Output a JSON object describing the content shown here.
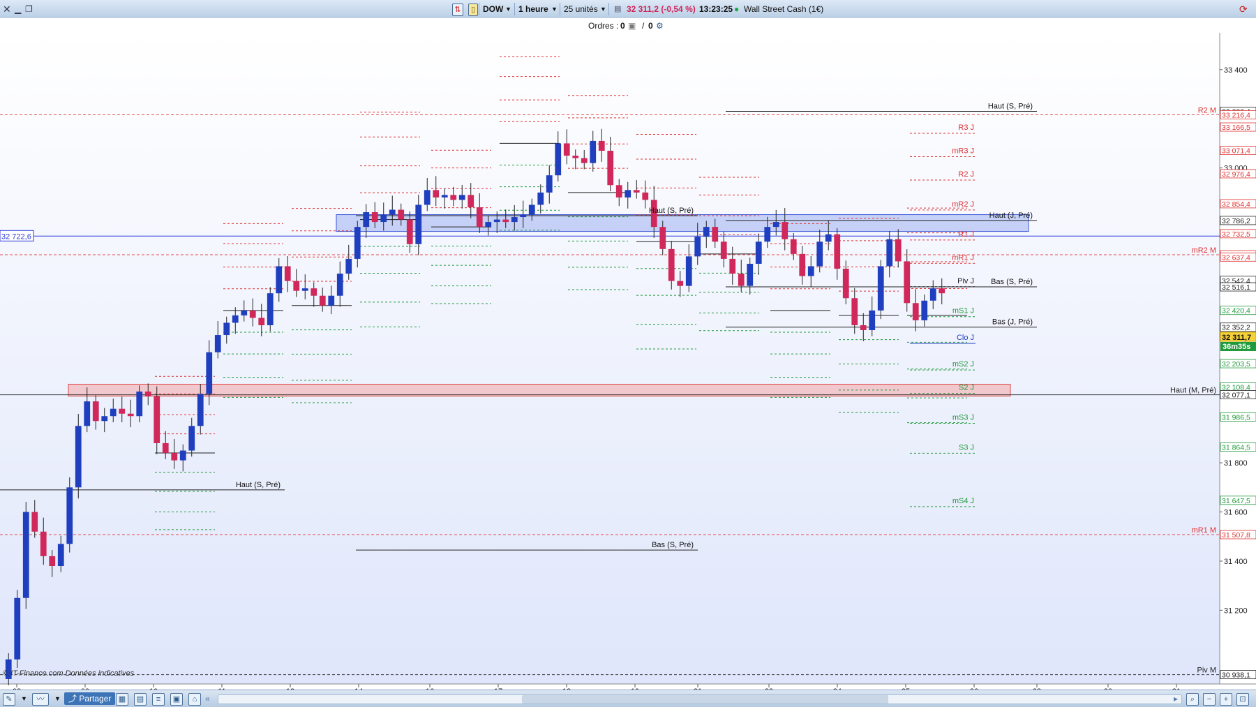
{
  "header": {
    "window_controls": [
      "close-icon",
      "minimize-icon",
      "restore-icon"
    ],
    "symbol": "DOW",
    "timeframe": "1 heure",
    "units": "25 unités",
    "price_info": "32 311,2 (-0,54 %)",
    "time": "13:23:25",
    "instrument": "Wall Street Cash (1€)"
  },
  "orders": {
    "label": "Ordres :",
    "open": "0",
    "sep": "/",
    "pending": "0"
  },
  "footer": {
    "watermark": "© IT-Finance.com  Données indicatives",
    "share_label": "Partager"
  },
  "colors": {
    "bull": "#1f3fbf",
    "bear": "#d0285a",
    "red_level": "#e03030",
    "green_level": "#1f9a3a",
    "zone_blue": "#9fb0f0",
    "zone_red": "#f4a6a6"
  },
  "chart_data": {
    "type": "candlestick",
    "instrument": "DOW",
    "interval": "1 heure",
    "ylim": [
      30900,
      33550
    ],
    "y_ticks": [
      31200,
      31400,
      31600,
      31800,
      33000,
      33400
    ],
    "x_ticks": [
      "08",
      "09",
      "10",
      "11",
      "12",
      "14",
      "16",
      "17",
      "18",
      "19",
      "21",
      "23",
      "24",
      "25",
      "26",
      "28",
      "30",
      "31"
    ],
    "current_price": "32 311,7",
    "countdown": "36m35s",
    "left_marker": "32 722,6",
    "price_labels": [
      {
        "text": "33 230,4",
        "value": 33230.4,
        "color": "#222222"
      },
      {
        "text": "33 216,4",
        "value": 33216.4,
        "color": "#e03030"
      },
      {
        "text": "33 166,5",
        "value": 33166.5,
        "color": "#e03030"
      },
      {
        "text": "33 071,4",
        "value": 33071.4,
        "color": "#e03030"
      },
      {
        "text": "32 976,4",
        "value": 32976.4,
        "color": "#e03030"
      },
      {
        "text": "32 854,4",
        "value": 32854.4,
        "color": "#e03030"
      },
      {
        "text": "32 786,2",
        "value": 32786.2,
        "color": "#222222"
      },
      {
        "text": "32 732,5",
        "value": 32732.5,
        "color": "#e03030"
      },
      {
        "text": "32 646,9",
        "value": 32646.9,
        "color": "#e03030"
      },
      {
        "text": "32 637,4",
        "value": 32637.4,
        "color": "#e03030"
      },
      {
        "text": "32 542,4",
        "value": 32542.4,
        "color": "#222222"
      },
      {
        "text": "32 516,1",
        "value": 32516.1,
        "color": "#222222"
      },
      {
        "text": "32 420,4",
        "value": 32420.4,
        "color": "#1f9a3a"
      },
      {
        "text": "32 352,2",
        "value": 32352.2,
        "color": "#222222"
      },
      {
        "text": "32 203,5",
        "value": 32203.5,
        "color": "#1f9a3a"
      },
      {
        "text": "32 108,4",
        "value": 32108.4,
        "color": "#1f9a3a"
      },
      {
        "text": "32 077,1",
        "value": 32077.1,
        "color": "#222222"
      },
      {
        "text": "31 986,5",
        "value": 31986.5,
        "color": "#1f9a3a"
      },
      {
        "text": "31 864,5",
        "value": 31864.5,
        "color": "#1f9a3a"
      },
      {
        "text": "31 647,5",
        "value": 31647.5,
        "color": "#1f9a3a"
      },
      {
        "text": "31 507,8",
        "value": 31507.8,
        "color": "#e03030"
      },
      {
        "text": "30 938,1",
        "value": 30938.1,
        "color": "#222222"
      }
    ],
    "monthly_levels": [
      {
        "label": "R2 M",
        "value": 33216.4,
        "color": "#e03030"
      },
      {
        "label": "mR2 M",
        "value": 32646.9,
        "color": "#e03030"
      },
      {
        "label": "Haut (M, Pré)",
        "value": 32077.1,
        "color": "#222222"
      },
      {
        "label": "mR1 M",
        "value": 31507.8,
        "color": "#e03030"
      },
      {
        "label": "Piv M",
        "value": 30938.1,
        "color": "#222222"
      }
    ],
    "daily_levels": [
      {
        "label": "R3 J",
        "value": 33166.5,
        "color": "#e03030"
      },
      {
        "label": "mR3 J",
        "value": 33071.4,
        "color": "#e03030"
      },
      {
        "label": "R2 J",
        "value": 32976.4,
        "color": "#e03030"
      },
      {
        "label": "mR2 J",
        "value": 32854.4,
        "color": "#e03030"
      },
      {
        "label": "R1 J",
        "value": 32732.5,
        "color": "#e03030"
      },
      {
        "label": "mR1 J",
        "value": 32637.4,
        "color": "#e03030"
      },
      {
        "label": "Piv J",
        "value": 32542.4,
        "color": "#222222"
      },
      {
        "label": "mS1 J",
        "value": 32420.4,
        "color": "#1f9a3a"
      },
      {
        "label": "Clo J",
        "value": 32311.7,
        "color": "#1f3fbf"
      },
      {
        "label": "mS2 J",
        "value": 32203.5,
        "color": "#1f9a3a"
      },
      {
        "label": "S2 J",
        "value": 32108.4,
        "color": "#1f9a3a"
      },
      {
        "label": "mS3 J",
        "value": 31986.5,
        "color": "#1f9a3a"
      },
      {
        "label": "S3 J",
        "value": 31864.5,
        "color": "#1f9a3a"
      },
      {
        "label": "mS4 J",
        "value": 31647.5,
        "color": "#1f9a3a"
      }
    ],
    "annotations": [
      {
        "label": "Haut (S, Pré)",
        "value": 33230.4,
        "date": "25"
      },
      {
        "label": "Haut (J, Pré)",
        "value": 32786.2,
        "date": "25"
      },
      {
        "label": "Bas (S, Pré)",
        "value": 32516.1,
        "date": "25"
      },
      {
        "label": "Bas (J, Pré)",
        "value": 32352.2,
        "date": "25"
      },
      {
        "label": "Haut (S, Pré)",
        "value": 32806,
        "date": "19"
      },
      {
        "label": "Haut (S, Pré)",
        "value": 31690,
        "date": "11"
      },
      {
        "label": "Bas (S, Pré)",
        "value": 31445,
        "date": "19"
      }
    ],
    "zones": [
      {
        "name": "blue-zone",
        "top": 32810,
        "bottom": 32770,
        "from": "14",
        "to": "26"
      },
      {
        "name": "red-zone",
        "top": 32120,
        "bottom": 32100,
        "from": "08",
        "to": "28"
      }
    ],
    "closes": [
      {
        "d": "08",
        "v": 31000
      },
      {
        "d": "08",
        "v": 31250
      },
      {
        "d": "08",
        "v": 31600
      },
      {
        "d": "08",
        "v": 31520
      },
      {
        "d": "08",
        "v": 31420
      },
      {
        "d": "08",
        "v": 31380
      },
      {
        "d": "08",
        "v": 31470
      },
      {
        "d": "08",
        "v": 31700
      },
      {
        "d": "08",
        "v": 31950
      },
      {
        "d": "09",
        "v": 32050
      },
      {
        "d": "09",
        "v": 31970
      },
      {
        "d": "09",
        "v": 31990
      },
      {
        "d": "09",
        "v": 32020
      },
      {
        "d": "09",
        "v": 32000
      },
      {
        "d": "09",
        "v": 31990
      },
      {
        "d": "09",
        "v": 32090
      },
      {
        "d": "09",
        "v": 32070
      },
      {
        "d": "09",
        "v": 31880
      },
      {
        "d": "10",
        "v": 31840
      },
      {
        "d": "10",
        "v": 31810
      },
      {
        "d": "10",
        "v": 31850
      },
      {
        "d": "10",
        "v": 31950
      },
      {
        "d": "10",
        "v": 32080
      },
      {
        "d": "10",
        "v": 32250
      },
      {
        "d": "10",
        "v": 32320
      },
      {
        "d": "10",
        "v": 32370
      },
      {
        "d": "10",
        "v": 32400
      },
      {
        "d": "11",
        "v": 32420
      },
      {
        "d": "11",
        "v": 32390
      },
      {
        "d": "11",
        "v": 32360
      },
      {
        "d": "11",
        "v": 32490
      },
      {
        "d": "11",
        "v": 32600
      },
      {
        "d": "11",
        "v": 32540
      },
      {
        "d": "11",
        "v": 32500
      },
      {
        "d": "11",
        "v": 32510
      },
      {
        "d": "11",
        "v": 32480
      },
      {
        "d": "12",
        "v": 32440
      },
      {
        "d": "12",
        "v": 32480
      },
      {
        "d": "12",
        "v": 32570
      },
      {
        "d": "12",
        "v": 32630
      },
      {
        "d": "12",
        "v": 32760
      },
      {
        "d": "12",
        "v": 32820
      },
      {
        "d": "12",
        "v": 32780
      },
      {
        "d": "12",
        "v": 32810
      },
      {
        "d": "12",
        "v": 32830
      },
      {
        "d": "14",
        "v": 32790
      },
      {
        "d": "14",
        "v": 32690
      },
      {
        "d": "14",
        "v": 32850
      },
      {
        "d": "14",
        "v": 32910
      },
      {
        "d": "14",
        "v": 32880
      },
      {
        "d": "14",
        "v": 32890
      },
      {
        "d": "14",
        "v": 32870
      },
      {
        "d": "14",
        "v": 32890
      },
      {
        "d": "14",
        "v": 32840
      },
      {
        "d": "16",
        "v": 32760
      },
      {
        "d": "16",
        "v": 32780
      },
      {
        "d": "16",
        "v": 32790
      },
      {
        "d": "16",
        "v": 32780
      },
      {
        "d": "16",
        "v": 32800
      },
      {
        "d": "16",
        "v": 32810
      },
      {
        "d": "16",
        "v": 32850
      },
      {
        "d": "16",
        "v": 32900
      },
      {
        "d": "16",
        "v": 32970
      },
      {
        "d": "17",
        "v": 33100
      },
      {
        "d": "17",
        "v": 33050
      },
      {
        "d": "17",
        "v": 33040
      },
      {
        "d": "17",
        "v": 33020
      },
      {
        "d": "17",
        "v": 33110
      },
      {
        "d": "17",
        "v": 33070
      },
      {
        "d": "17",
        "v": 32930
      },
      {
        "d": "17",
        "v": 32880
      },
      {
        "d": "17",
        "v": 32910
      },
      {
        "d": "18",
        "v": 32900
      },
      {
        "d": "18",
        "v": 32870
      },
      {
        "d": "18",
        "v": 32760
      },
      {
        "d": "18",
        "v": 32670
      },
      {
        "d": "18",
        "v": 32540
      },
      {
        "d": "18",
        "v": 32520
      },
      {
        "d": "18",
        "v": 32640
      },
      {
        "d": "18",
        "v": 32720
      },
      {
        "d": "18",
        "v": 32760
      },
      {
        "d": "19",
        "v": 32700
      },
      {
        "d": "19",
        "v": 32630
      },
      {
        "d": "19",
        "v": 32570
      },
      {
        "d": "19",
        "v": 32520
      },
      {
        "d": "19",
        "v": 32610
      },
      {
        "d": "19",
        "v": 32700
      },
      {
        "d": "19",
        "v": 32760
      },
      {
        "d": "19",
        "v": 32780
      },
      {
        "d": "19",
        "v": 32710
      },
      {
        "d": "21",
        "v": 32650
      },
      {
        "d": "21",
        "v": 32560
      },
      {
        "d": "21",
        "v": 32600
      },
      {
        "d": "21",
        "v": 32700
      },
      {
        "d": "21",
        "v": 32730
      },
      {
        "d": "21",
        "v": 32590
      },
      {
        "d": "21",
        "v": 32470
      },
      {
        "d": "21",
        "v": 32360
      },
      {
        "d": "21",
        "v": 32340
      },
      {
        "d": "23",
        "v": 32420
      },
      {
        "d": "23",
        "v": 32600
      },
      {
        "d": "23",
        "v": 32710
      },
      {
        "d": "23",
        "v": 32620
      },
      {
        "d": "23",
        "v": 32450
      },
      {
        "d": "23",
        "v": 32380
      },
      {
        "d": "23",
        "v": 32460
      },
      {
        "d": "23",
        "v": 32510
      },
      {
        "d": "23",
        "v": 32490
      }
    ]
  }
}
